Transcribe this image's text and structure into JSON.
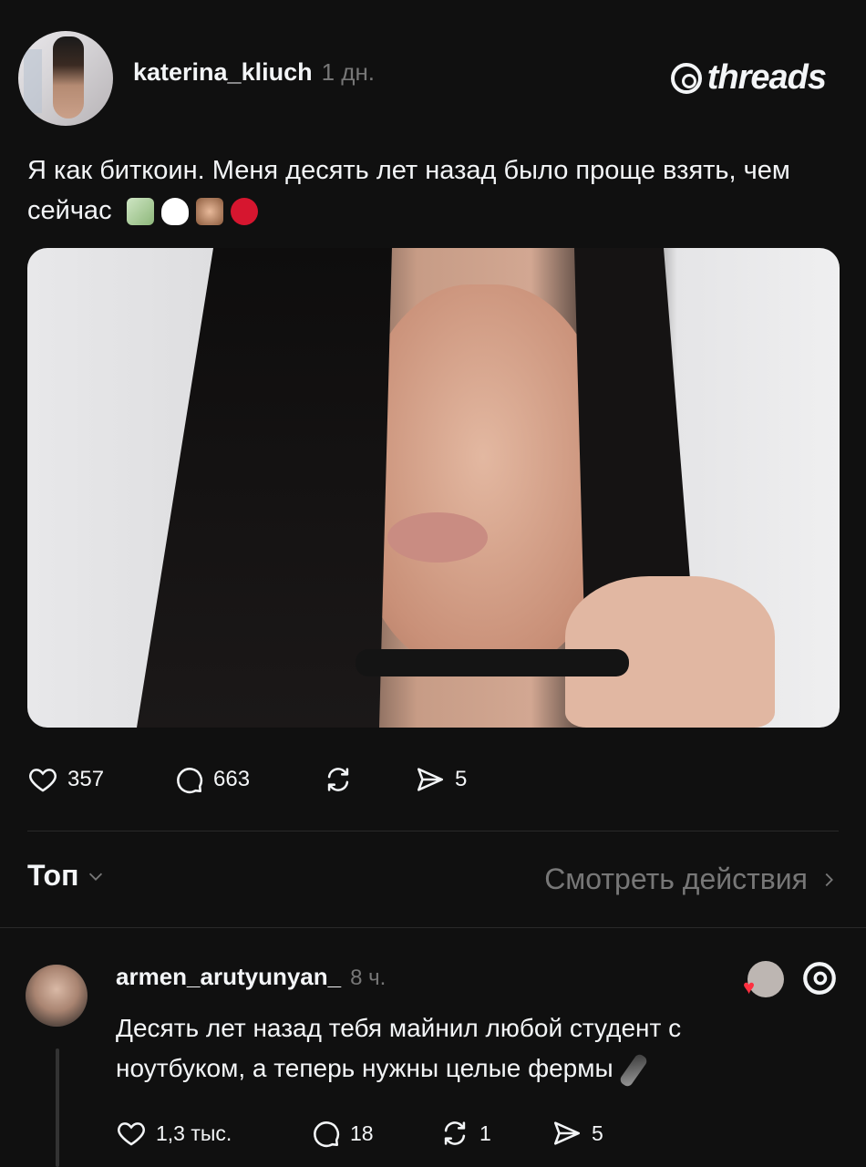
{
  "post": {
    "username": "katerina_kliuch",
    "time": "1 дн.",
    "text": "Я как биткоин. Меня десять лет назад было проще взять, чем сейчас",
    "emojis": [
      "money-wings-emoji",
      "white-heart-emoji",
      "see-no-evil-monkey-emoji",
      "kiss-mark-emoji"
    ],
    "stats": {
      "likes": "357",
      "comments": "663",
      "shares": "5"
    }
  },
  "brand": {
    "logo_text": "threads"
  },
  "sort": {
    "label": "Топ"
  },
  "activity": {
    "label": "Смотреть действия"
  },
  "reply": {
    "username": "armen_arutyunyan_",
    "time": "8 ч.",
    "text": "Десять лет назад тебя майнил любой студент с ноутбуком, а теперь нужны целые фермы",
    "emoji": "electric-plug-emoji",
    "stats": {
      "likes": "1,3 тыс.",
      "comments": "18",
      "reposts": "1",
      "shares": "5"
    }
  },
  "colors": {
    "background": "#101010",
    "text": "#f3f5f7",
    "muted": "#777777",
    "like_red": "#ff3040"
  }
}
